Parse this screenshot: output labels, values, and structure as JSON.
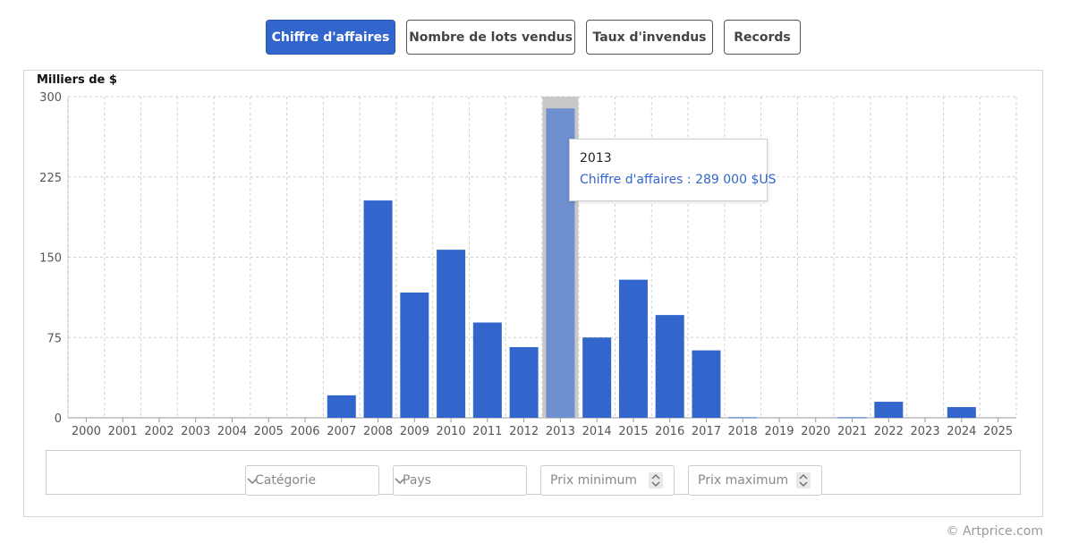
{
  "tabs": [
    {
      "label": "Chiffre d'affaires",
      "active": true
    },
    {
      "label": "Nombre de lots vendus",
      "active": false
    },
    {
      "label": "Taux d'invendus",
      "active": false
    },
    {
      "label": "Records",
      "active": false
    }
  ],
  "colors": {
    "bar": "#3366cc",
    "bar_highlight": "#6e8fd0",
    "hover_band": "#c8c8c8",
    "grid": "#cfcfcf"
  },
  "chart_data": {
    "type": "bar",
    "ylabel": "Milliers de $",
    "ylim": [
      0,
      300
    ],
    "yticks": [
      0,
      75,
      150,
      225,
      300
    ],
    "grid": true,
    "categories": [
      "2000",
      "2001",
      "2002",
      "2003",
      "2004",
      "2005",
      "2006",
      "2007",
      "2008",
      "2009",
      "2010",
      "2011",
      "2012",
      "2013",
      "2014",
      "2015",
      "2016",
      "2017",
      "2018",
      "2019",
      "2020",
      "2021",
      "2022",
      "2023",
      "2024",
      "2025"
    ],
    "series": [
      {
        "values": [
          0,
          0,
          0,
          0,
          0,
          0,
          0,
          21,
          203,
          117,
          157,
          89,
          66,
          289,
          75,
          129,
          96,
          63,
          0.5,
          0,
          0,
          0.5,
          15,
          0,
          10,
          0
        ]
      }
    ],
    "highlighted_category": "2013"
  },
  "tooltip": {
    "title": "2013",
    "text": "Chiffre d'affaires : 289 000 $US"
  },
  "filters": {
    "category_placeholder": "Catégorie",
    "country_placeholder": "Pays",
    "min_price_placeholder": "Prix minimum",
    "max_price_placeholder": "Prix maximum"
  },
  "footer": {
    "copyright": "© Artprice.com"
  }
}
